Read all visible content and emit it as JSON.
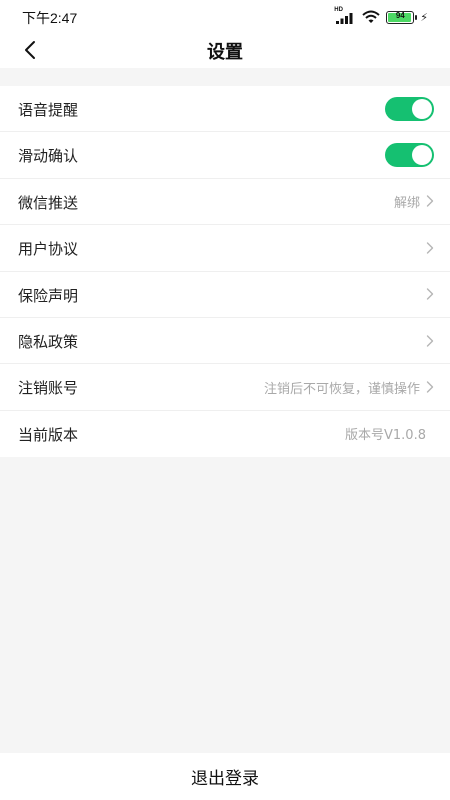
{
  "status_bar": {
    "time": "下午2:47",
    "network_label": "HD",
    "battery_level": "94",
    "battery_color": "#4cd964"
  },
  "nav": {
    "title": "设置",
    "back_icon": "chevron-left-icon"
  },
  "settings": [
    {
      "label": "语音提醒",
      "type": "toggle",
      "on": true
    },
    {
      "label": "滑动确认",
      "type": "toggle",
      "on": true
    },
    {
      "label": "微信推送",
      "type": "link",
      "value": "解绑"
    },
    {
      "label": "用户协议",
      "type": "link",
      "value": ""
    },
    {
      "label": "保险声明",
      "type": "link",
      "value": ""
    },
    {
      "label": "隐私政策",
      "type": "link",
      "value": ""
    },
    {
      "label": "注销账号",
      "type": "link",
      "value": "注销后不可恢复，谨慎操作"
    },
    {
      "label": "当前版本",
      "type": "text",
      "value": "版本号V1.0.8"
    }
  ],
  "logout_label": "退出登录",
  "accent_color": "#15c071"
}
